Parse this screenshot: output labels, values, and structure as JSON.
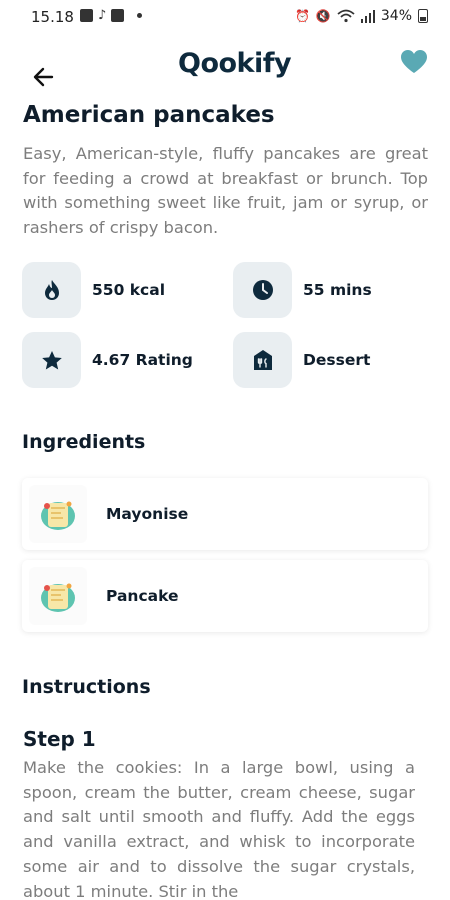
{
  "status_bar": {
    "time": "15.18",
    "battery": "34%"
  },
  "header": {
    "logo_text": "Qookify",
    "back_icon": "arrow-left-icon",
    "favorite_icon": "heart-icon"
  },
  "recipe": {
    "title": "American pancakes",
    "description": "Easy, American-style, fluffy pancakes are great for feeding a crowd at breakfast or brunch. Top with something sweet like fruit, jam or syrup, or rashers of crispy bacon."
  },
  "info": {
    "calories": "550 kcal",
    "time": "55 mins",
    "rating": "4.67 Rating",
    "category": "Dessert"
  },
  "ingredients": {
    "heading": "Ingredients",
    "items": [
      {
        "name": "Mayonise"
      },
      {
        "name": "Pancake"
      }
    ]
  },
  "instructions": {
    "heading": "Instructions",
    "steps": [
      {
        "title": "Step 1",
        "text": "Make the cookies: In a large bowl, using a spoon, cream the butter, cream cheese, sugar and salt until smooth and fluffy. Add the eggs and vanilla extract, and whisk to incorporate some air and to dissolve the sugar crystals, about 1 minute. Stir in the"
      }
    ]
  },
  "colors": {
    "primary": "#0f1d2b",
    "accent": "#5aa9b4",
    "muted_text": "#7d7d7d",
    "chip_bg": "#e9eef1"
  }
}
